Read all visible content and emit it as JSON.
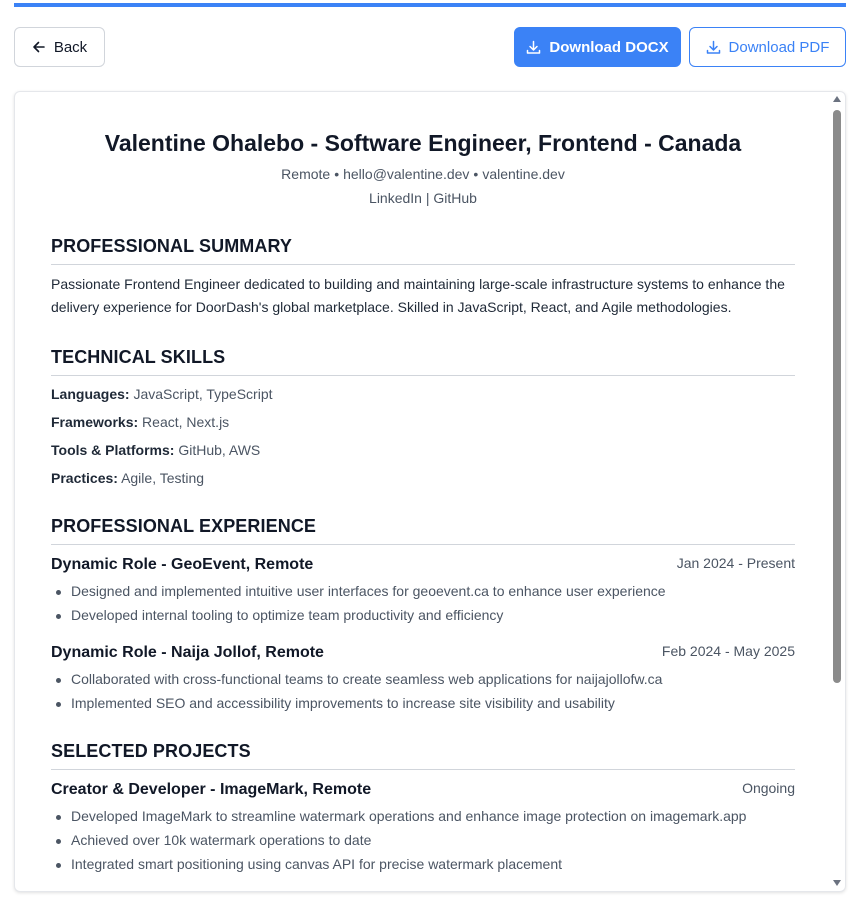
{
  "colors": {
    "accent": "#3b82f6",
    "text": "#1f2937",
    "muted": "#4b5563"
  },
  "toolbar": {
    "back_label": "Back",
    "docx_label": "Download DOCX",
    "pdf_label": "Download PDF"
  },
  "resume": {
    "name": "Valentine Ohalebo - Software Engineer, Frontend - Canada",
    "contact": {
      "location": "Remote",
      "email": "hello@valentine.dev",
      "website": "valentine.dev",
      "links": [
        "LinkedIn",
        "GitHub"
      ],
      "bullet_sep": "•",
      "pipe_sep": "|"
    },
    "summary": {
      "title": "PROFESSIONAL SUMMARY",
      "text": "Passionate Frontend Engineer dedicated to building and maintaining large-scale infrastructure systems to enhance the delivery experience for DoorDash's global marketplace. Skilled in JavaScript, React, and Agile methodologies."
    },
    "skills": {
      "title": "TECHNICAL SKILLS",
      "items": [
        {
          "label": "Languages:",
          "value": "JavaScript, TypeScript"
        },
        {
          "label": "Frameworks:",
          "value": "React, Next.js"
        },
        {
          "label": "Tools & Platforms:",
          "value": "GitHub, AWS"
        },
        {
          "label": "Practices:",
          "value": "Agile, Testing"
        }
      ]
    },
    "experience": {
      "title": "PROFESSIONAL EXPERIENCE",
      "jobs": [
        {
          "role": "Dynamic Role - GeoEvent, Remote",
          "date": "Jan 2024 - Present",
          "bullets": [
            "Designed and implemented intuitive user interfaces for geoevent.ca to enhance user experience",
            "Developed internal tooling to optimize team productivity and efficiency"
          ]
        },
        {
          "role": "Dynamic Role - Naija Jollof, Remote",
          "date": "Feb 2024 - May 2025",
          "bullets": [
            "Collaborated with cross-functional teams to create seamless web applications for naijajollofw.ca",
            "Implemented SEO and accessibility improvements to increase site visibility and usability"
          ]
        }
      ]
    },
    "projects": {
      "title": "SELECTED PROJECTS",
      "items": [
        {
          "role": "Creator & Developer - ImageMark, Remote",
          "date": "Ongoing",
          "bullets": [
            "Developed ImageMark to streamline watermark operations and enhance image protection on imagemark.app",
            "Achieved over 10k watermark operations to date",
            "Integrated smart positioning using canvas API for precise watermark placement"
          ]
        }
      ]
    }
  }
}
